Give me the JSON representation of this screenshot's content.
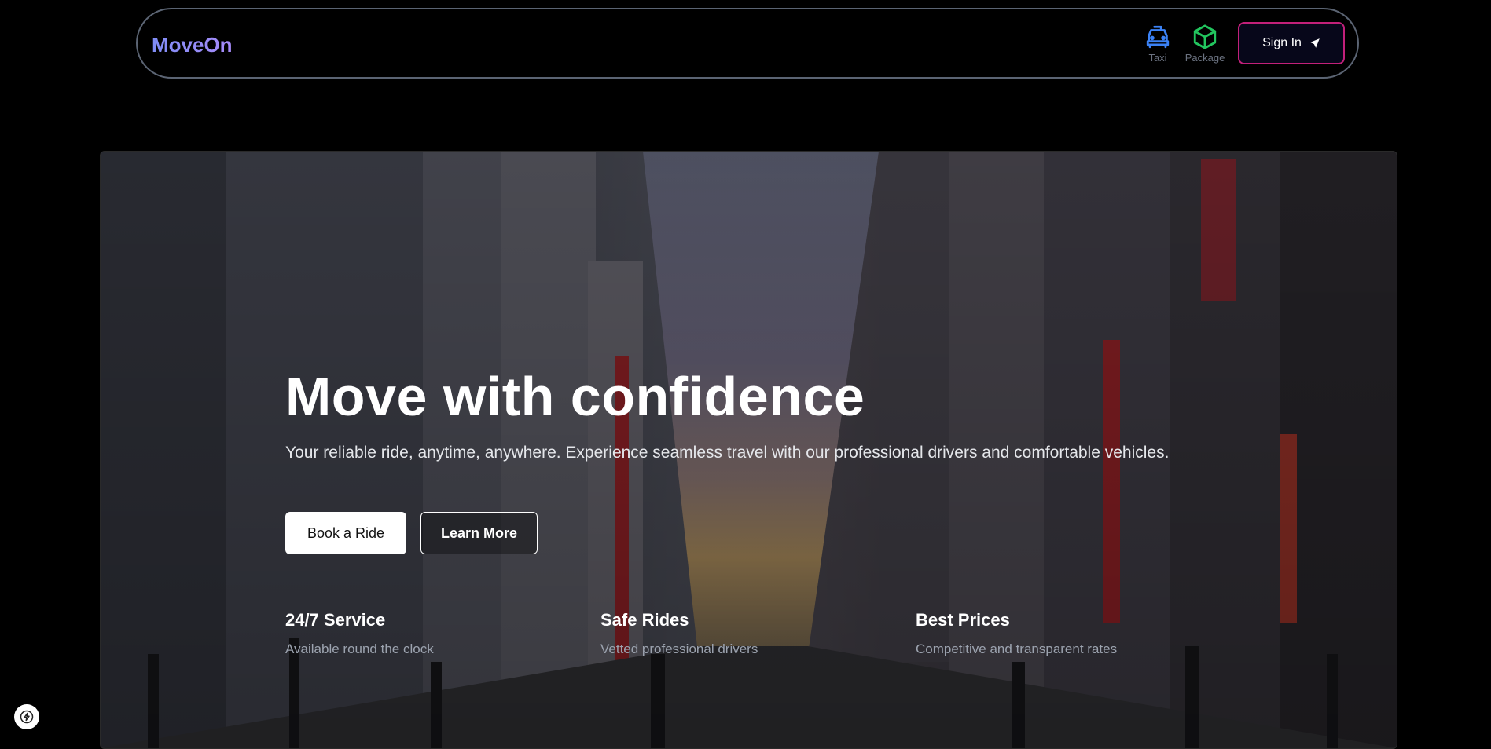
{
  "nav": {
    "brand": "MoveOn",
    "services": [
      {
        "label": "Taxi",
        "icon": "car-icon",
        "color": "#3b82f6"
      },
      {
        "label": "Package",
        "icon": "package-icon",
        "color": "#22c55e"
      }
    ],
    "sign_in_label": "Sign In",
    "sign_in_icon": "send-arrow-icon",
    "accent": "#c2207a"
  },
  "hero": {
    "title": "Move with confidence",
    "subtitle": "Your reliable ride, anytime, anywhere. Experience seamless travel with our professional drivers and comfortable vehicles.",
    "primary_cta": "Book a Ride",
    "secondary_cta": "Learn More",
    "background": "city-street-photo"
  },
  "features": [
    {
      "title": "24/7 Service",
      "description": "Available round the clock"
    },
    {
      "title": "Safe Rides",
      "description": "Vetted professional drivers"
    },
    {
      "title": "Best Prices",
      "description": "Competitive and transparent rates"
    }
  ],
  "dev_badge_icon": "lightning-icon"
}
